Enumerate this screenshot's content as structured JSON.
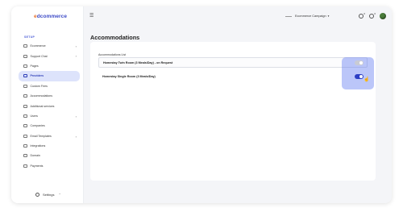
{
  "app": {
    "logo_prefix": "e",
    "logo_text": "dcommerce"
  },
  "sidebar": {
    "section_label": "SETUP",
    "items": [
      {
        "label": "Ecommerce",
        "icon": "cart-icon",
        "expandable": true,
        "active": false
      },
      {
        "label": "Support Chat",
        "icon": "chat-icon",
        "expandable": true,
        "active": false
      },
      {
        "label": "Pages",
        "icon": "page-icon",
        "expandable": false,
        "active": false
      },
      {
        "label": "Providers",
        "icon": "providers-icon",
        "expandable": false,
        "active": true
      },
      {
        "label": "Custom Fees",
        "icon": "fees-icon",
        "expandable": false,
        "active": false
      },
      {
        "label": "Accommodations",
        "icon": "bed-icon",
        "expandable": false,
        "active": false
      },
      {
        "label": "Additional services",
        "icon": "services-icon",
        "expandable": false,
        "active": false
      },
      {
        "label": "Users",
        "icon": "users-icon",
        "expandable": true,
        "active": false
      },
      {
        "label": "Companies",
        "icon": "companies-icon",
        "expandable": false,
        "active": false
      },
      {
        "label": "Email Templates",
        "icon": "email-icon",
        "expandable": true,
        "active": false
      },
      {
        "label": "Integrations",
        "icon": "integrations-icon",
        "expandable": false,
        "active": false
      },
      {
        "label": "Domain",
        "icon": "domain-icon",
        "expandable": false,
        "active": false
      },
      {
        "label": "Payments",
        "icon": "payments-icon",
        "expandable": false,
        "active": false
      }
    ],
    "settings_label": "Settings"
  },
  "topbar": {
    "campaign_label": "Ecommerce Campaign",
    "notification_count": "0",
    "message_count": "0"
  },
  "main": {
    "title": "Accommodations",
    "list_label": "Accommodations List",
    "rows": [
      {
        "name": "Homestay Twin Room (3 Meals/Day) - on Request",
        "enabled": false
      },
      {
        "name": "Homestay Single Room (3 Meals/Day)",
        "enabled": true
      }
    ]
  },
  "colors": {
    "accent": "#2d3fc4",
    "active_nav_bg": "#dde3fb",
    "highlight": "#5e76f0",
    "logo_mark": "#e8702a"
  }
}
